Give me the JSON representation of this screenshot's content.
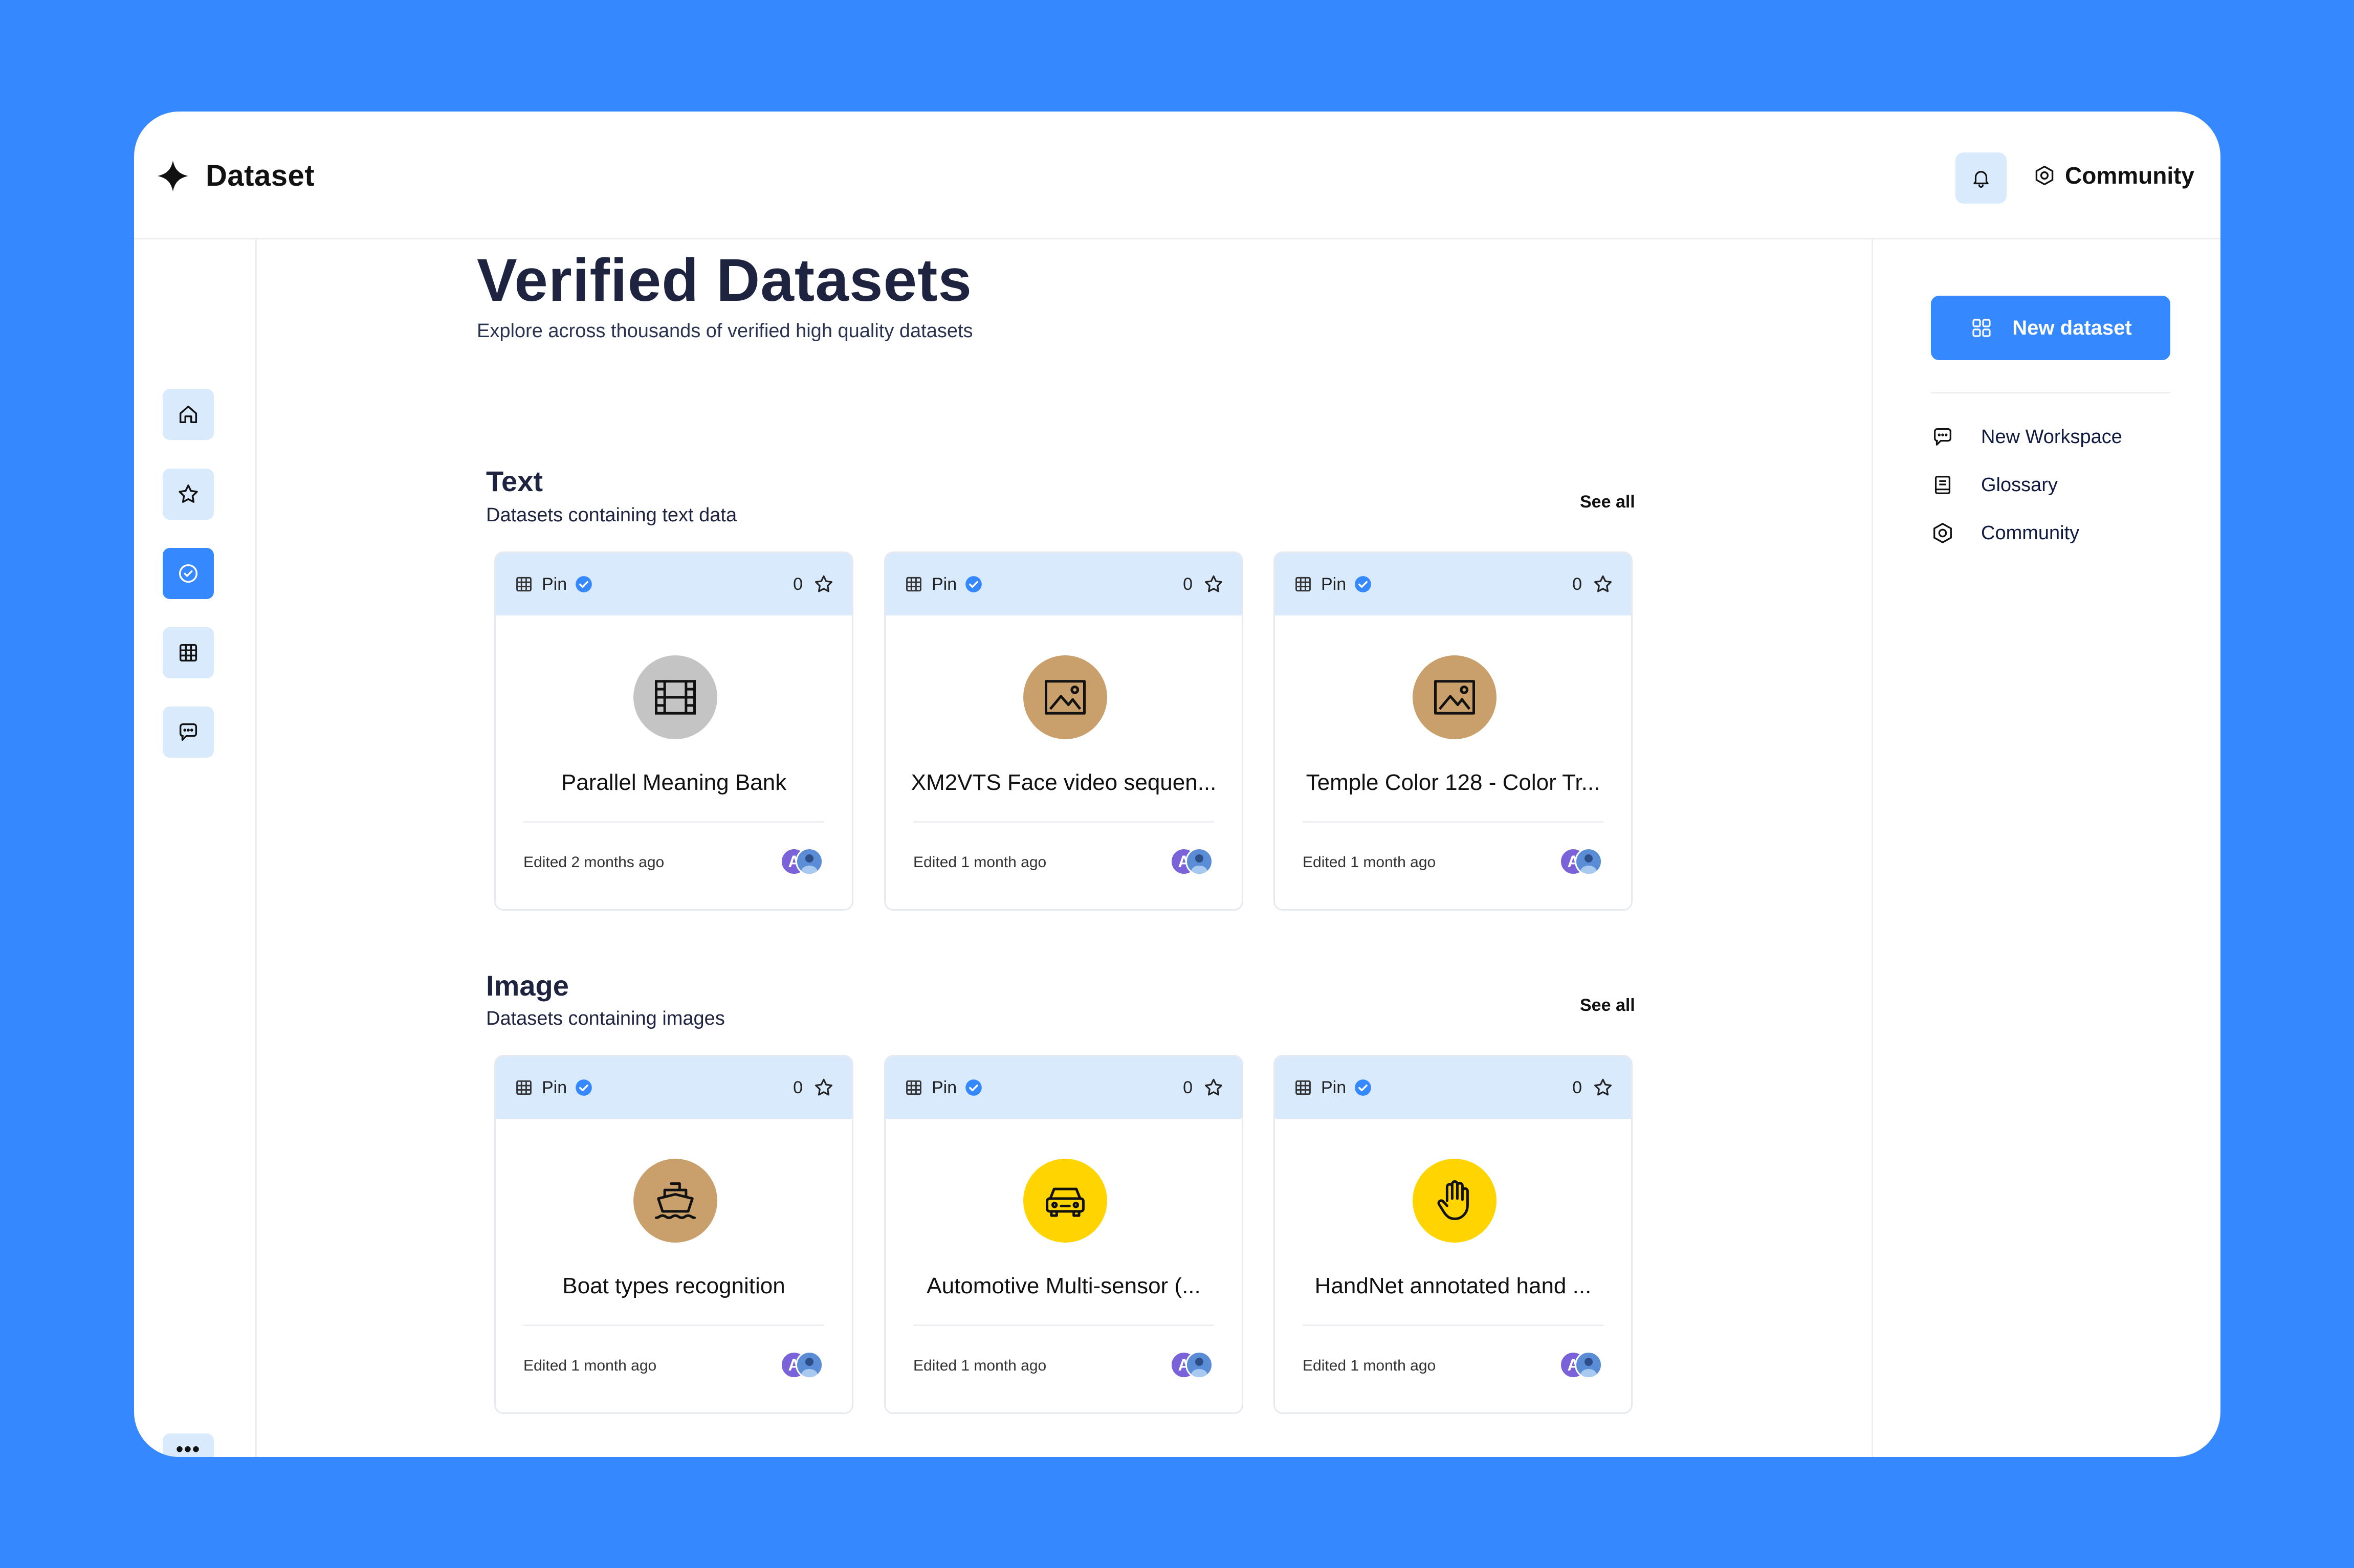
{
  "app": {
    "title": "Dataset"
  },
  "header": {
    "community_label": "Community"
  },
  "main": {
    "title": "Verified Datasets",
    "subtitle": "Explore across thousands of verified high quality datasets"
  },
  "right_panel": {
    "new_dataset_label": "New dataset",
    "links": [
      {
        "label": "New Workspace",
        "icon": "chat-icon"
      },
      {
        "label": "Glossary",
        "icon": "book-icon"
      },
      {
        "label": "Community",
        "icon": "hexagon-icon"
      }
    ]
  },
  "sections": [
    {
      "title": "Text",
      "subtitle": "Datasets containing text data",
      "see_all": "See all",
      "cards": [
        {
          "pin": "Pin",
          "count": "0",
          "name": "Parallel Meaning Bank",
          "edited": "Edited 2 months ago",
          "icon": "film-icon",
          "icon_bg": "#C4C4C4"
        },
        {
          "pin": "Pin",
          "count": "0",
          "name": "XM2VTS Face video sequen...",
          "edited": "Edited 1 month ago",
          "icon": "image-icon",
          "icon_bg": "#C9A06C"
        },
        {
          "pin": "Pin",
          "count": "0",
          "name": "Temple Color 128 - Color Tr...",
          "edited": "Edited 1 month ago",
          "icon": "image-icon",
          "icon_bg": "#C9A06C"
        }
      ]
    },
    {
      "title": "Image",
      "subtitle": "Datasets containing images",
      "see_all": "See all",
      "cards": [
        {
          "pin": "Pin",
          "count": "0",
          "name": "Boat types recognition",
          "edited": "Edited 1 month ago",
          "icon": "ship-icon",
          "icon_bg": "#C9A06C"
        },
        {
          "pin": "Pin",
          "count": "0",
          "name": "Automotive Multi-sensor (...",
          "edited": "Edited 1 month ago",
          "icon": "car-icon",
          "icon_bg": "#FFD400"
        },
        {
          "pin": "Pin",
          "count": "0",
          "name": "HandNet annotated hand ...",
          "edited": "Edited 1 month ago",
          "icon": "hand-icon",
          "icon_bg": "#FFD400"
        }
      ]
    }
  ],
  "colors": {
    "background": "#3588FD",
    "accent": "#3588FD",
    "card_header": "#D8EAFC"
  }
}
